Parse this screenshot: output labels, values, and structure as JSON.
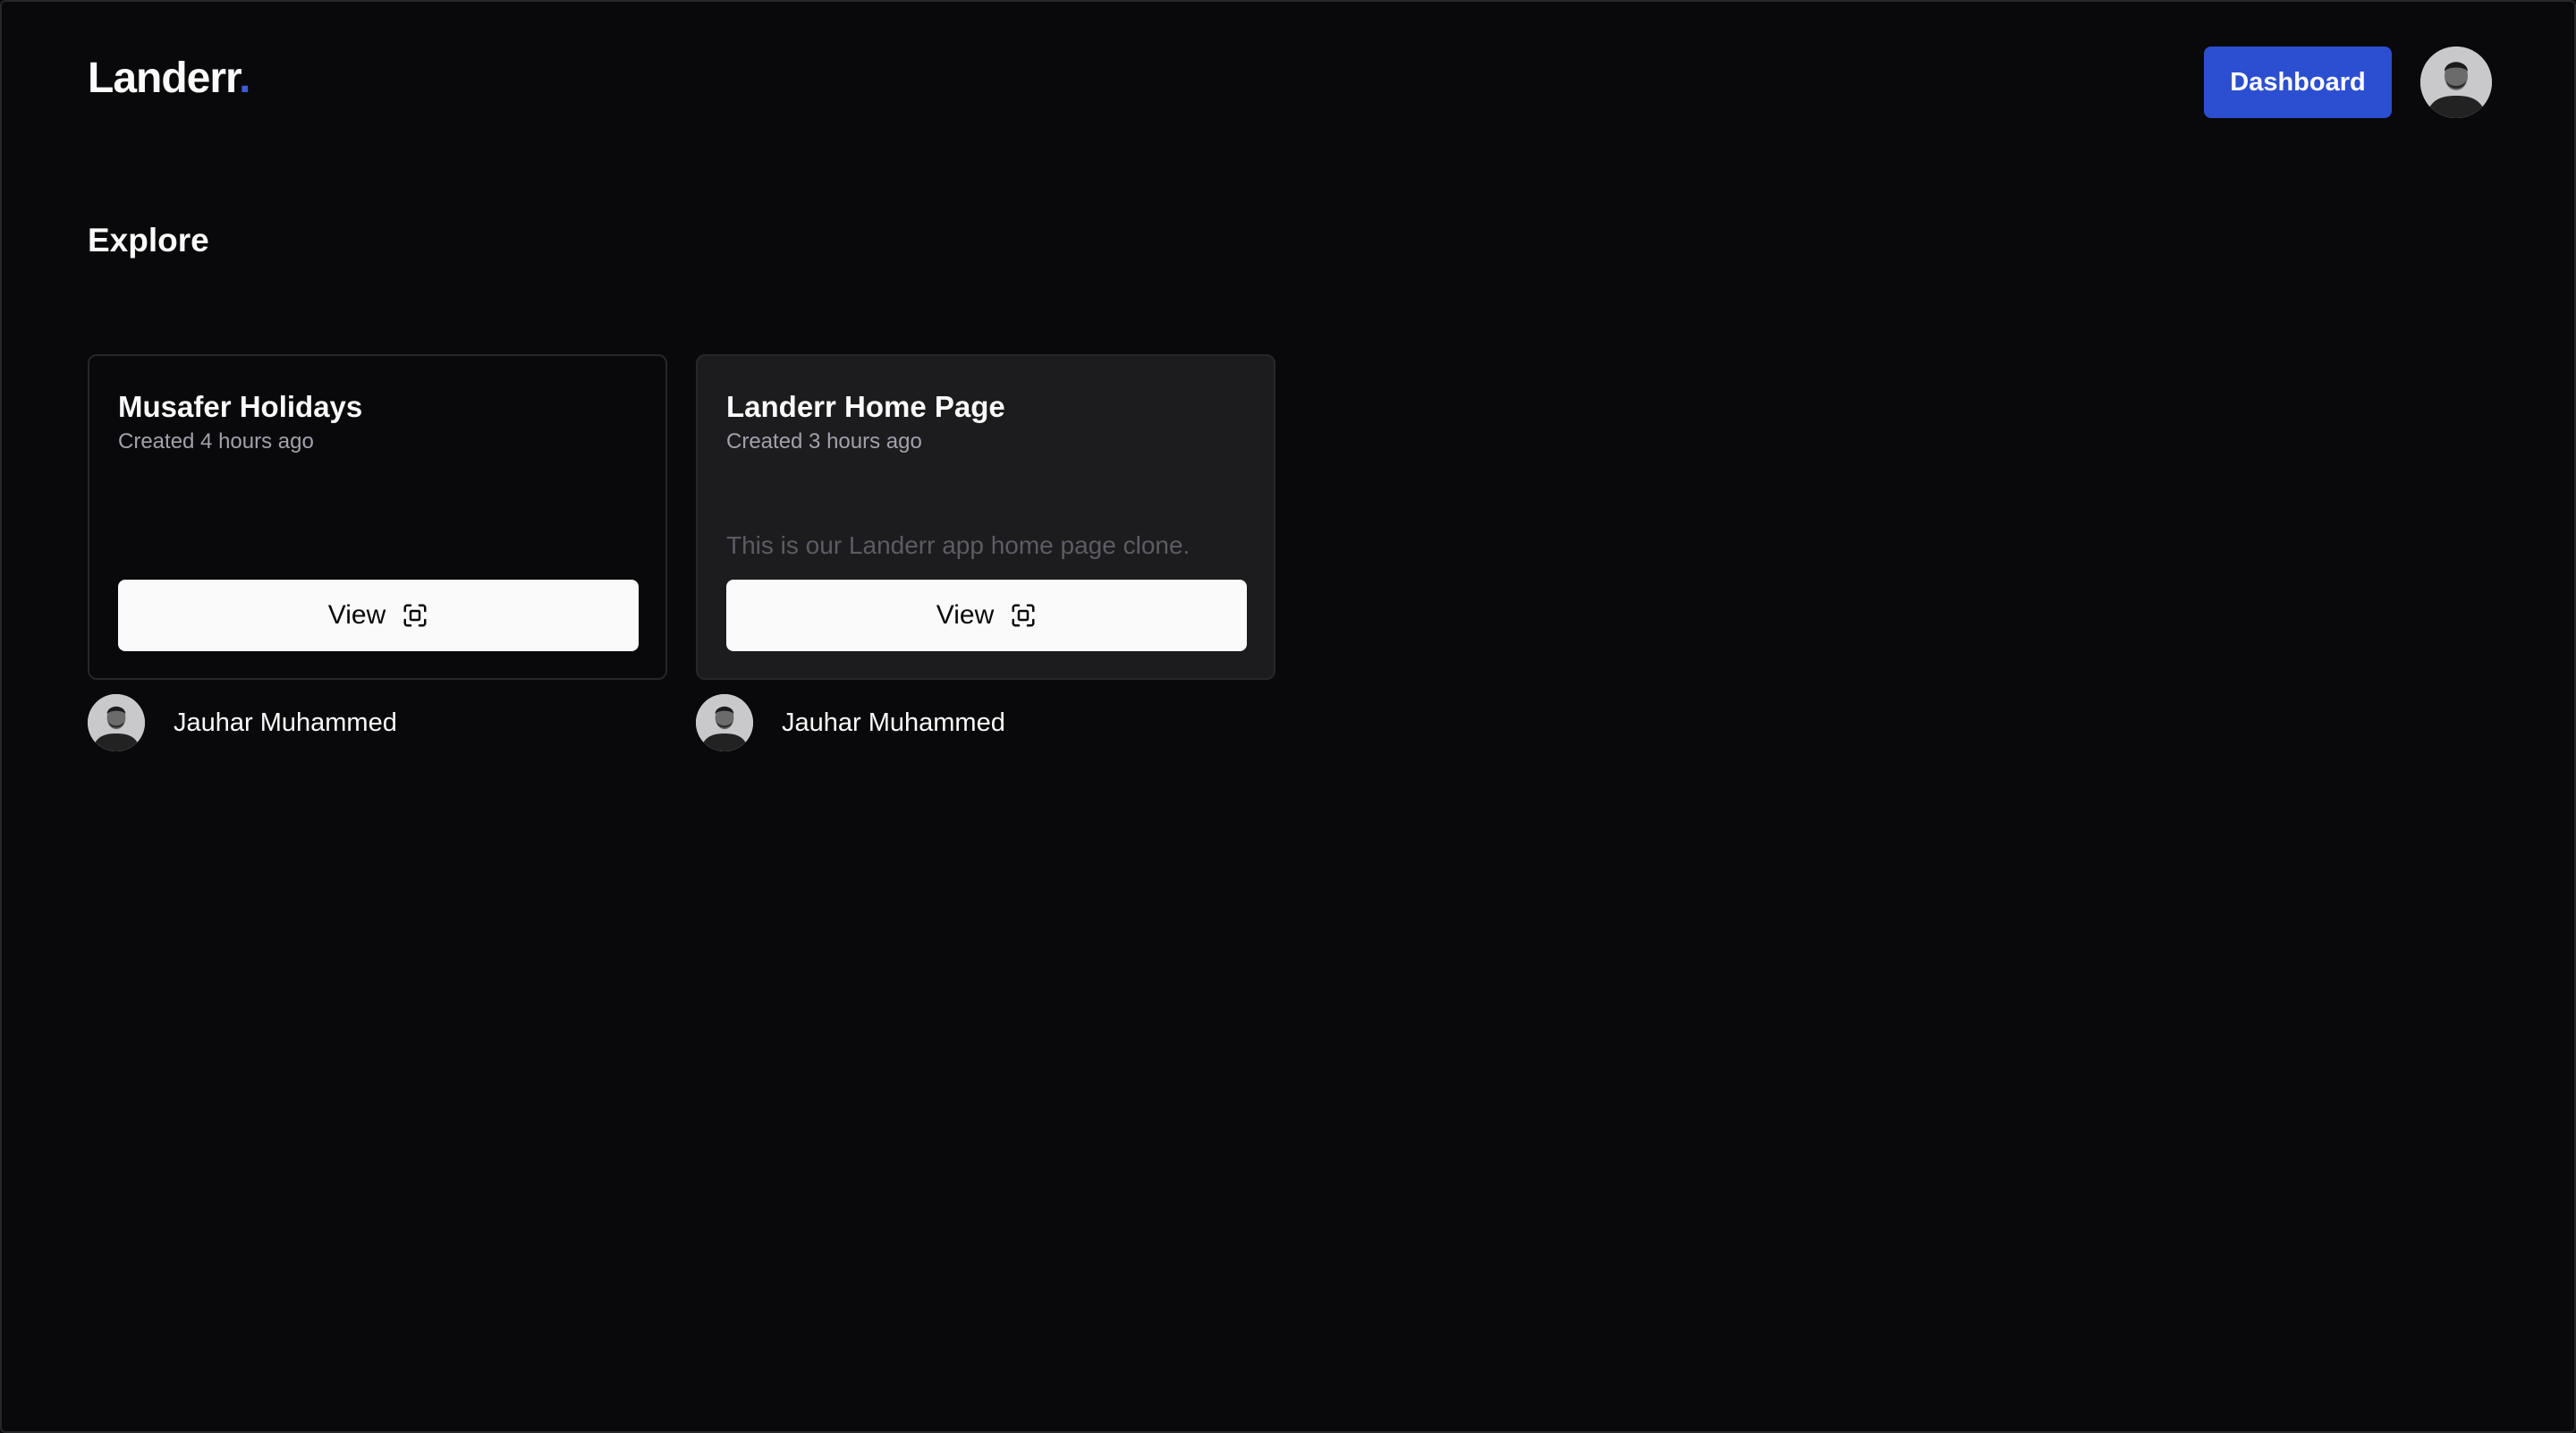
{
  "header": {
    "logo_text": "Landerr",
    "logo_dot": ".",
    "dashboard_label": "Dashboard",
    "user_avatar_icon": "user-avatar-photo"
  },
  "main": {
    "title": "Explore",
    "cards": [
      {
        "title": "Musafer Holidays",
        "created": "Created 4 hours ago",
        "description": "",
        "view_label": "View",
        "view_icon": "fullscreen-icon",
        "author": "Jauhar Muhammed"
      },
      {
        "title": "Landerr Home Page",
        "created": "Created 3 hours ago",
        "description": "This is our Landerr app home page clone.",
        "view_label": "View",
        "view_icon": "fullscreen-icon",
        "author": "Jauhar Muhammed"
      }
    ]
  },
  "colors": {
    "background": "#09090b",
    "accent": "#2b4fd0",
    "card_border": "#27272a",
    "card_alt_bg": "#1c1c1f",
    "muted_text": "#a1a1aa"
  }
}
